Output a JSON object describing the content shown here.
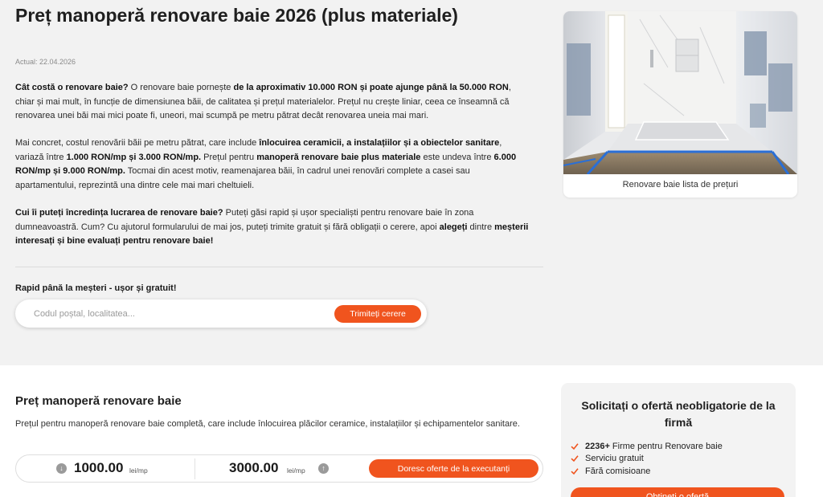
{
  "header": {
    "title": "Preț manoperă renovare baie 2026 (plus materiale)",
    "updated": "Actual: 22.04.2026"
  },
  "intro": {
    "p1": [
      {
        "t": "Cât costă o renovare baie?",
        "b": true
      },
      {
        "t": " O renovare baie pornește ",
        "b": false
      },
      {
        "t": "de la aproximativ 10.000 RON și poate ajunge până la 50.000 RON",
        "b": true
      },
      {
        "t": ", chiar și mai mult, în funcție de dimensiunea băii, de calitatea și prețul materialelor. Prețul nu crește liniar, ceea ce înseamnă că renovarea unei băi mai mici poate fi, uneori, mai scumpă pe metru pătrat decât renovarea uneia mai mari.",
        "b": false
      }
    ],
    "p2": [
      {
        "t": "Mai concret, costul renovării băii pe metru pătrat, care include ",
        "b": false
      },
      {
        "t": "înlocuirea ceramicii, a instalațiilor și a obiectelor sanitare",
        "b": true
      },
      {
        "t": ", variază între ",
        "b": false
      },
      {
        "t": "1.000 RON/mp și 3.000 RON/mp.",
        "b": true
      },
      {
        "t": " Prețul pentru ",
        "b": false
      },
      {
        "t": "manoperă renovare baie plus materiale",
        "b": true
      },
      {
        "t": " este undeva între ",
        "b": false
      },
      {
        "t": "6.000 RON/mp și 9.000 RON/mp.",
        "b": true
      },
      {
        "t": " Tocmai din acest motiv, reamenajarea băii, în cadrul unei renovări complete a casei sau apartamentului, reprezintă una dintre cele mai mari cheltuieli.",
        "b": false
      }
    ],
    "p3": [
      {
        "t": "Cui îi puteți încredința lucrarea de renovare baie?",
        "b": true
      },
      {
        "t": " Puteți găsi rapid și ușor specialiști pentru renovare baie în zona dumneavoastră. Cum? Cu ajutorul formularului de mai jos, puteți trimite gratuit și fără obligații o cerere, apoi ",
        "b": false
      },
      {
        "t": "alegeți",
        "b": true
      },
      {
        "t": " dintre ",
        "b": false
      },
      {
        "t": "meșterii interesați și bine evaluați pentru renovare baie!",
        "b": true
      }
    ]
  },
  "quick_form": {
    "label": "Rapid până la meșteri - ușor și gratuit!",
    "placeholder": "Codul poștal, localitatea...",
    "button": "Trimiteți cerere"
  },
  "photo": {
    "caption": "Renovare baie lista de prețuri"
  },
  "pricing": {
    "title": "Preț manoperă renovare baie",
    "description": "Prețul pentru manoperă renovare baie completă, care include înlocuirea plăcilor ceramice, instalațiilor și echipamentelor sanitare.",
    "min_value": "1000.00",
    "max_value": "3000.00",
    "unit": "lei/mp",
    "button": "Doresc oferte de la executanți"
  },
  "offer_card": {
    "title": "Solicitați o ofertă neobligatorie de la firmă",
    "items": [
      {
        "bold": "2236+",
        "text": "Firme pentru Renovare baie"
      },
      {
        "bold": "",
        "text": "Serviciu gratuit"
      },
      {
        "bold": "",
        "text": "Fără comisioane"
      }
    ],
    "button": "Obțineți o ofertă"
  },
  "colors": {
    "accent": "#f0541e",
    "hero_background": "#f2f2f2",
    "check": "#f0541e"
  },
  "icons": {
    "min_price": "arrow-down-circle-icon",
    "max_price": "arrow-up-circle-icon",
    "list": "check-icon"
  }
}
